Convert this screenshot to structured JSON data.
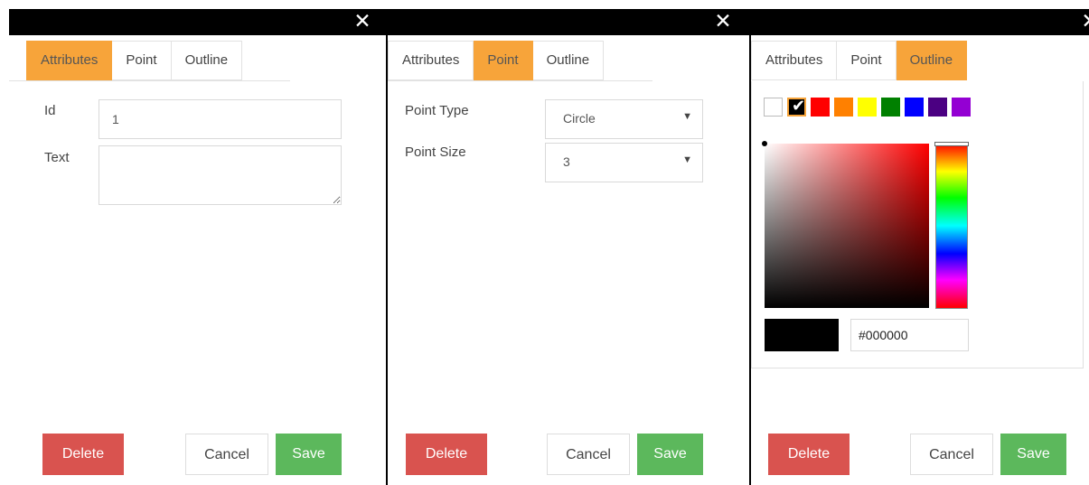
{
  "dialogs": [
    {
      "close_glyph": "✕",
      "tabs": [
        "Attributes",
        "Point",
        "Outline"
      ],
      "active_tab": "Attributes",
      "attributes": {
        "id_label": "Id",
        "id_value": "1",
        "text_label": "Text",
        "text_value": ""
      },
      "buttons": {
        "delete": "Delete",
        "cancel": "Cancel",
        "save": "Save"
      }
    },
    {
      "close_glyph": "✕",
      "tabs": [
        "Attributes",
        "Point",
        "Outline"
      ],
      "active_tab": "Point",
      "point": {
        "type_label": "Point Type",
        "type_value": "Circle",
        "size_label": "Point Size",
        "size_value": "3",
        "caret": "▼"
      },
      "buttons": {
        "delete": "Delete",
        "cancel": "Cancel",
        "save": "Save"
      }
    },
    {
      "close_glyph": "✕",
      "tabs": [
        "Attributes",
        "Point",
        "Outline"
      ],
      "active_tab": "Outline",
      "outline": {
        "swatches": [
          "#ffffff",
          "#000000",
          "#ff0000",
          "#ff8000",
          "#ffff00",
          "#008000",
          "#0000ff",
          "#4b0082",
          "#9400d3"
        ],
        "selected_swatch": "#000000",
        "check_glyph": "✔",
        "hue": "#ff0000",
        "hex_value": "#000000"
      },
      "buttons": {
        "delete": "Delete",
        "cancel": "Cancel",
        "save": "Save"
      }
    }
  ],
  "colors": {
    "accent_tab": "#f7a43a",
    "delete": "#d9534f",
    "save": "#5cb85c",
    "titlebar": "#000000"
  }
}
